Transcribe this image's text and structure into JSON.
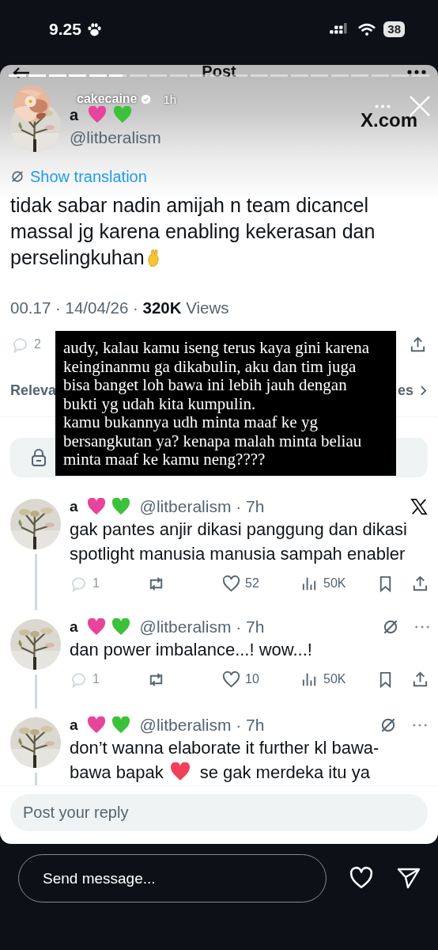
{
  "status_bar": {
    "time": "9.25",
    "battery": "38"
  },
  "header": {
    "title": "Post"
  },
  "story": {
    "progress": {
      "level": 0.27
    },
    "username": "cakecaine",
    "verified": true,
    "age": "1h"
  },
  "post": {
    "name": "a",
    "name_icons": [
      {
        "color": "#e8449c"
      },
      {
        "color": "#3cc13a"
      }
    ],
    "handle": "@litberalism",
    "source": "X.com",
    "translate_link": "Show translation",
    "segments": [
      {
        "kind": "line",
        "text": "tidak sabar nadin amijah n team dicancel massal jg karena enabling kekerasan dan"
      },
      {
        "kind": "text",
        "text": "perselingkuhan"
      },
      {
        "kind": "hand"
      }
    ],
    "meta": "00.17 · 14/04/26 · **320K** Views",
    "reply_count": "2"
  },
  "sort": {
    "left": "Releva",
    "right": "es"
  },
  "caption": "audy, kalau kamu iseng terus kaya gini karena\nkeinginanmu ga dikabulin, aku dan tim juga\nbisa banget loh bawa ini lebih jauh dengan\nbukti yg udah kita kumpulin.\nkamu bukannya udh minta maaf ke yg\nbersangkutan ya? kenapa malah minta beliau\nminta maaf ke kamu neng????",
  "replies": [
    {
      "name": "a",
      "name_icons": [
        {
          "color": "#e8449c"
        },
        {
          "color": "#3cc13a"
        }
      ],
      "handle_time": "@litberalism · 7h",
      "corner_icon": {
        "kind": "x-logo"
      },
      "more": false,
      "segments": [
        {
          "kind": "text",
          "text": "gak pantes anjir dikasi panggung dan dikasi spotlight manusia manusia sampah enabler"
        }
      ],
      "actions": {
        "replies": "1",
        "likes": "52",
        "views": "50K"
      }
    },
    {
      "name": "a",
      "name_icons": [
        {
          "color": "#e8449c"
        },
        {
          "color": "#3cc13a"
        }
      ],
      "handle_time": "@litberalism · 7h",
      "corner_icon": {
        "kind": "grok"
      },
      "more": true,
      "segments": [
        {
          "kind": "text",
          "text": "dan power imbalance...! wow...!"
        }
      ],
      "actions": {
        "replies": "1",
        "likes": "10",
        "views": "50K"
      }
    },
    {
      "name": "a",
      "name_icons": [
        {
          "color": "#e8449c"
        },
        {
          "color": "#3cc13a"
        }
      ],
      "handle_time": "@litberalism · 7h",
      "corner_icon": {
        "kind": "grok"
      },
      "more": true,
      "segments": [
        {
          "kind": "line",
          "text": "don’t wanna elaborate it further kl bawa-"
        },
        {
          "kind": "text",
          "text": "bawa bapak"
        },
        {
          "kind": "heart"
        },
        {
          "kind": "text",
          "text": "se gak merdeka itu ya"
        }
      ]
    }
  ],
  "reply_field": {
    "placeholder": "Post your reply"
  },
  "message_field": {
    "placeholder": "Send message..."
  }
}
